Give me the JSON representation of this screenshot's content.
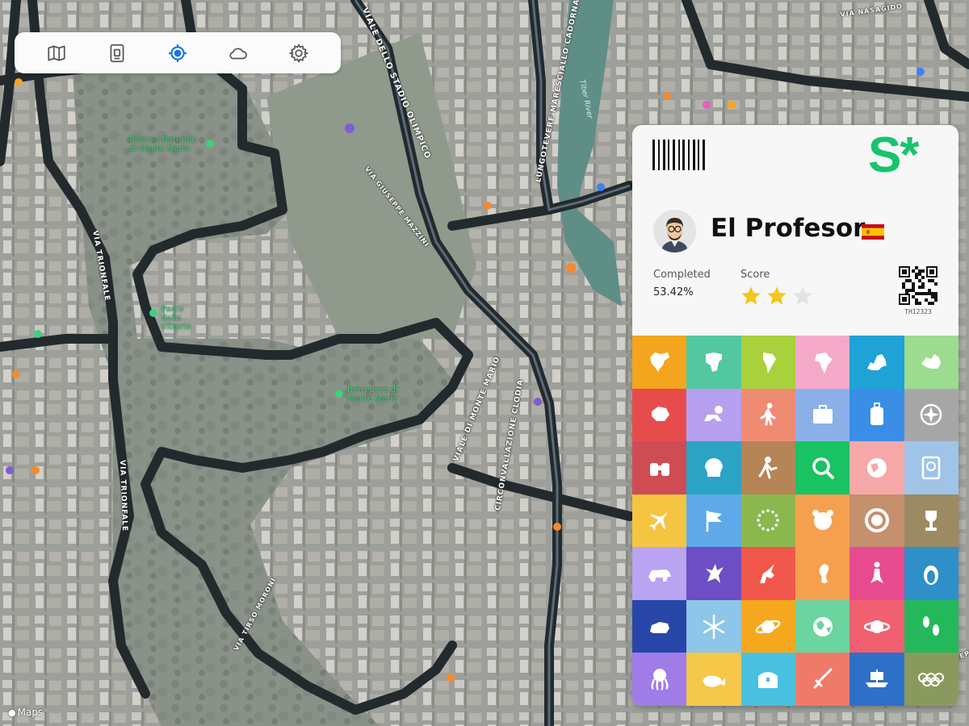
{
  "toolbar": {
    "buttons": [
      {
        "name": "map-icon",
        "active": false
      },
      {
        "name": "passport-icon",
        "active": false
      },
      {
        "name": "target-icon",
        "active": true
      },
      {
        "name": "cloud-icon",
        "active": false
      },
      {
        "name": "gear-icon",
        "active": false
      }
    ],
    "active_color": "#1a73e8",
    "icon_color": "#555555"
  },
  "map": {
    "attribution": "Maps",
    "road_labels": [
      "VIALE DELLO STADIO OLIMPICO",
      "LUNGOTEVERE MARESCIALLO CADORNA",
      "VIA TRIONFALE",
      "VIA TRIONFALE",
      "VIA GIUSEPPE MAZZINI",
      "CIRCONVALLAZIONE CLODIA",
      "VIALE DI MONTE MARIO",
      "VIA NASAGIDO",
      "VIA GIUSEPPE",
      "VIA TIRSO MORONI"
    ],
    "poi_labels": [
      "Riserva Naturale di Monte Mario",
      "Parco della Vittoria",
      "Belvedere di Monte Mario"
    ],
    "river_label": "Tiber River"
  },
  "card": {
    "brand": "S*",
    "brand_color": "#17c46b",
    "name": "El Profesor",
    "flag": "Spain",
    "completed_label": "Completed",
    "completed_value": "53.42%",
    "score_label": "Score",
    "stars": 2,
    "max_stars": 3,
    "qr_id": "TH12323",
    "tiles": [
      {
        "icon": "north-america-icon",
        "color": "#f4a51e"
      },
      {
        "icon": "africa-map-icon",
        "color": "#52c7a0"
      },
      {
        "icon": "south-america-icon",
        "color": "#a9d13c"
      },
      {
        "icon": "africa-icon",
        "color": "#f5a9c8"
      },
      {
        "icon": "europe-icon",
        "color": "#1fa2d6"
      },
      {
        "icon": "australia-icon",
        "color": "#9bdc8f"
      },
      {
        "icon": "antarctica-icon",
        "color": "#e74c4c"
      },
      {
        "icon": "crawling-baby-icon",
        "color": "#b79ff0"
      },
      {
        "icon": "walking-person-icon",
        "color": "#f08b73"
      },
      {
        "icon": "suitcase-icon",
        "color": "#8bb0e8"
      },
      {
        "icon": "luggage-icon",
        "color": "#3a8ee6"
      },
      {
        "icon": "compass-icon",
        "color": "#a6a6a6"
      },
      {
        "icon": "binoculars-icon",
        "color": "#cf4c55"
      },
      {
        "icon": "skull-icon",
        "color": "#2aa3c4"
      },
      {
        "icon": "explorer-icon",
        "color": "#b58457"
      },
      {
        "icon": "magnifier-icon",
        "color": "#19c263"
      },
      {
        "icon": "globe-icon",
        "color": "#f6a8a8"
      },
      {
        "icon": "passport-icon",
        "color": "#9fc4e8"
      },
      {
        "icon": "airplane-icon",
        "color": "#f5c542"
      },
      {
        "icon": "flag-icon",
        "color": "#5fa9e8"
      },
      {
        "icon": "eu-stars-icon",
        "color": "#8ab84f"
      },
      {
        "icon": "tiger-icon",
        "color": "#f5a04f"
      },
      {
        "icon": "lion-icon",
        "color": "#c4906e"
      },
      {
        "icon": "trophy-icon",
        "color": "#9b8a62"
      },
      {
        "icon": "bear-icon",
        "color": "#b8a4f0"
      },
      {
        "icon": "dragon-icon",
        "color": "#6d4ec4"
      },
      {
        "icon": "unicorn-icon",
        "color": "#f0574a"
      },
      {
        "icon": "seahorse-icon",
        "color": "#f5a04f"
      },
      {
        "icon": "mermaid-icon",
        "color": "#e84a8f"
      },
      {
        "icon": "penguin-icon",
        "color": "#2f8fc8"
      },
      {
        "icon": "polar-bear-icon",
        "color": "#2845a8"
      },
      {
        "icon": "snowflake-icon",
        "color": "#8dc6e8"
      },
      {
        "icon": "saturn-icon",
        "color": "#f5a81e"
      },
      {
        "icon": "earth-icon",
        "color": "#6cd49e"
      },
      {
        "icon": "planet-ring-icon",
        "color": "#f06070"
      },
      {
        "icon": "footprints-icon",
        "color": "#25b85a"
      },
      {
        "icon": "octopus-icon",
        "color": "#a07ce8"
      },
      {
        "icon": "whale-icon",
        "color": "#f5c84a"
      },
      {
        "icon": "treasure-chest-icon",
        "color": "#4ac0e0"
      },
      {
        "icon": "sword-icon",
        "color": "#f07a6a"
      },
      {
        "icon": "viking-ship-icon",
        "color": "#2e6fc8"
      },
      {
        "icon": "olympic-rings-icon",
        "color": "#8a9a5e"
      }
    ]
  }
}
